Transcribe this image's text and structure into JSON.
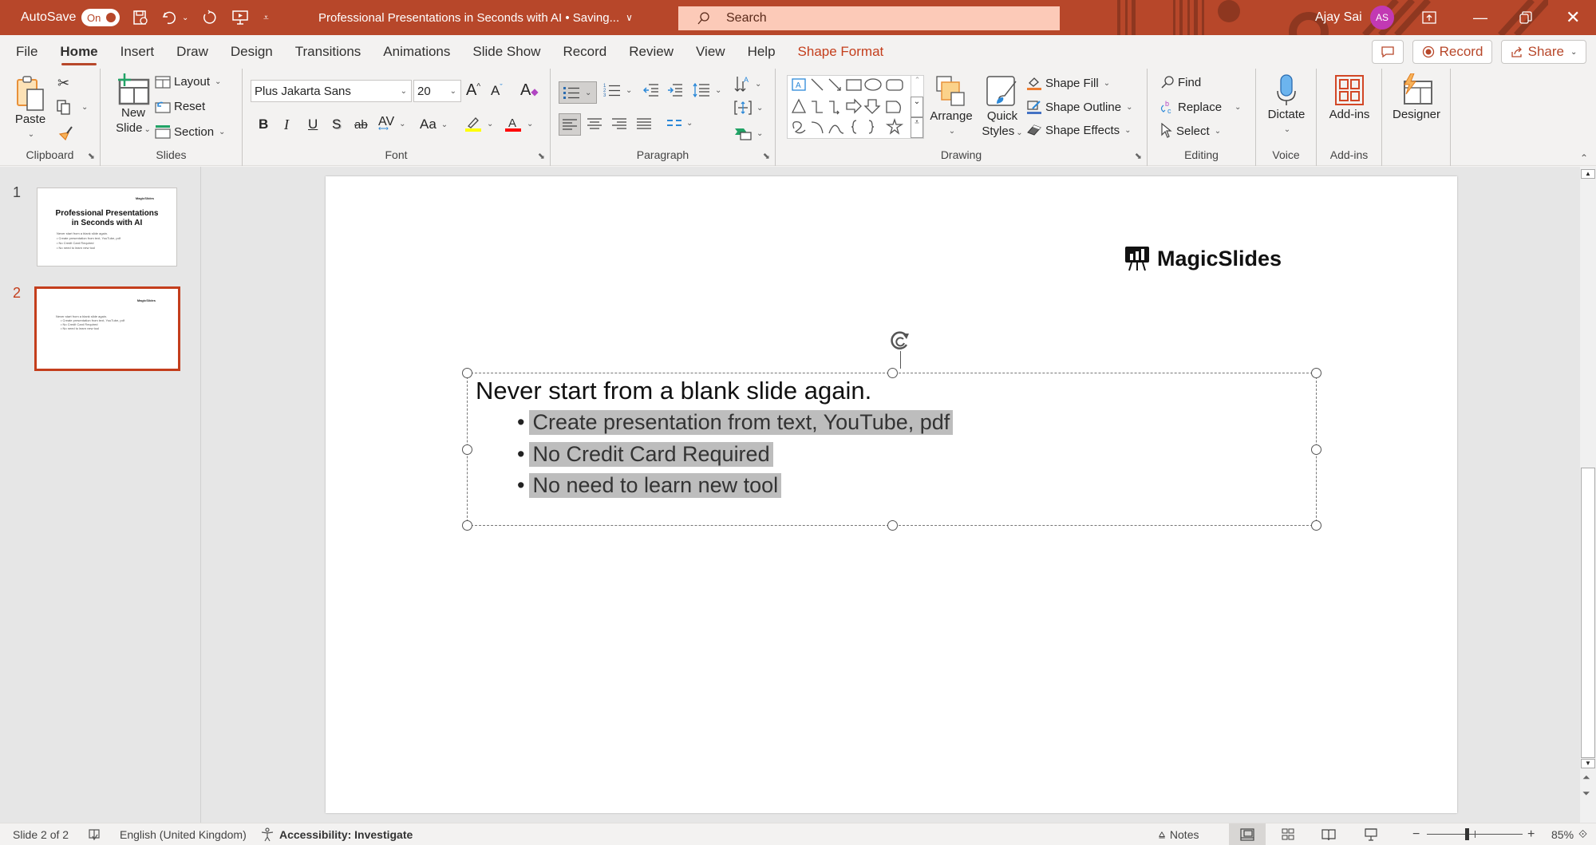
{
  "titlebar": {
    "autosave_label": "AutoSave",
    "autosave_state": "On",
    "doc_title": "Professional Presentations in Seconds with AI • Saving...",
    "search_placeholder": "Search",
    "user_name": "Ajay Sai",
    "user_initials": "AS",
    "brand_color": "#b7472a"
  },
  "menu": {
    "tabs": [
      {
        "label": "File"
      },
      {
        "label": "Home",
        "active": true
      },
      {
        "label": "Insert"
      },
      {
        "label": "Draw"
      },
      {
        "label": "Design"
      },
      {
        "label": "Transitions"
      },
      {
        "label": "Animations"
      },
      {
        "label": "Slide Show"
      },
      {
        "label": "Record"
      },
      {
        "label": "Review"
      },
      {
        "label": "View"
      },
      {
        "label": "Help"
      },
      {
        "label": "Shape Format",
        "contextual": true
      }
    ],
    "record_button": "Record",
    "share_button": "Share"
  },
  "ribbon": {
    "clipboard": {
      "label": "Clipboard",
      "paste": "Paste"
    },
    "slides": {
      "label": "Slides",
      "new_slide_line1": "New",
      "new_slide_line2": "Slide",
      "layout": "Layout",
      "reset": "Reset",
      "section": "Section"
    },
    "font": {
      "label": "Font",
      "font_name": "Plus Jakarta Sans",
      "font_size": "20",
      "highlight_color": "#ffff00",
      "font_color": "#ff0000"
    },
    "paragraph": {
      "label": "Paragraph"
    },
    "drawing": {
      "label": "Drawing",
      "arrange": "Arrange",
      "quick_styles_line1": "Quick",
      "quick_styles_line2": "Styles",
      "shape_fill": "Shape Fill",
      "shape_outline": "Shape Outline",
      "shape_effects": "Shape Effects"
    },
    "editing": {
      "label": "Editing",
      "find": "Find",
      "replace": "Replace",
      "select": "Select"
    },
    "voice": {
      "label": "Voice",
      "dictate": "Dictate"
    },
    "addins": {
      "label": "Add-ins",
      "addins": "Add-ins"
    },
    "designer": {
      "designer": "Designer"
    }
  },
  "thumbnails": [
    {
      "number": "1",
      "title": "Professional Presentations in Seconds with AI",
      "selected": false
    },
    {
      "number": "2",
      "selected": true
    }
  ],
  "slide": {
    "logo_text": "MagicSlides",
    "heading": "Never start from a blank slide again.",
    "bullets": [
      "Create presentation from text, YouTube, pdf",
      "No Credit Card Required",
      "No need to learn new tool"
    ]
  },
  "statusbar": {
    "slide_indicator": "Slide 2 of 2",
    "language": "English (United Kingdom)",
    "accessibility": "Accessibility: Investigate",
    "notes": "Notes",
    "zoom": "85%",
    "zoom_fraction": 0.85
  }
}
